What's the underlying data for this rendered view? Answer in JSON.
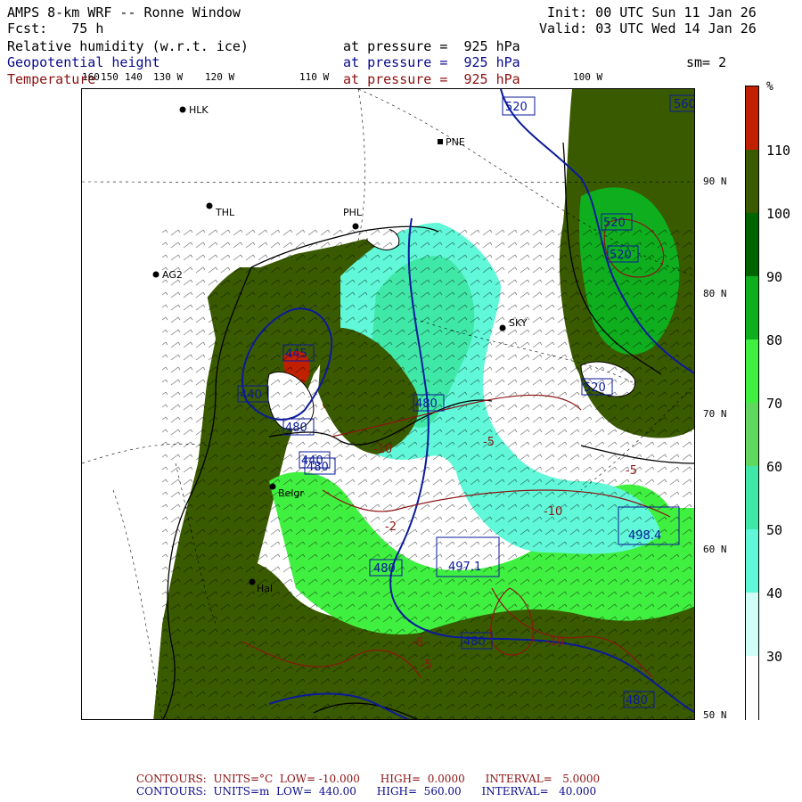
{
  "header": {
    "title": "AMPS 8-km WRF -- Ronne Window",
    "fcst": "Fcst:   75 h",
    "init": "Init: 00 UTC Sun 11 Jan 26",
    "valid": "Valid: 03 UTC Wed 14 Jan 26",
    "field1_name": "Relative humidity (w.r.t. ice)",
    "field1_level": "at pressure =  925 hPa",
    "field2_name": "Geopotential height",
    "field2_level": "at pressure =  925 hPa",
    "field3_name": "Temperature",
    "field3_level": "at pressure =  925 hPa",
    "smoothing": "sm= 2"
  },
  "longitude_labels": [
    "160",
    "150",
    "140",
    "130 W",
    "120 W",
    "110 W",
    "100 W"
  ],
  "latitude_labels": [
    "90 N",
    "80 N",
    "70 N",
    "60 N",
    "50 N"
  ],
  "station_labels": [
    "HLK",
    "PNE",
    "THL",
    "PHL",
    "AG2",
    "SKY",
    "Belgr",
    "Hal"
  ],
  "height_labels": [
    "520",
    "560",
    "520",
    "520",
    "445",
    "440",
    "480",
    "480",
    "520",
    "440",
    "480",
    "498.4",
    "497.1",
    "480",
    "480",
    "480"
  ],
  "temperature_labels": [
    "-5",
    "-10",
    "-2",
    "-5",
    "-10",
    "-6",
    "-5",
    "-10"
  ],
  "colorbar": {
    "unit": "%",
    "labels": [
      "110",
      "100",
      "90",
      "80",
      "70",
      "60",
      "50",
      "40",
      "30"
    ],
    "colors": [
      "#c02000",
      "#3a5a00",
      "#006400",
      "#0fae1e",
      "#40f040",
      "#60d860",
      "#40e8a8",
      "#60f8d8",
      "#d0fff8",
      "#ffffff"
    ]
  },
  "footer": {
    "temp_contours": "CONTOURS:  UNITS=°C  LOW= -10.000      HIGH=  0.0000      INTERVAL=   5.0000",
    "height_contours": "CONTOURS:  UNITS=m  LOW=  440.00      HIGH=  560.00      INTERVAL=   40.000"
  },
  "colors": {
    "height_contour": "#0a1a9c",
    "temp_contour": "#8c1414",
    "coast": "#000000",
    "label_blue": "#0a0a8c",
    "label_red": "#8c1010"
  }
}
